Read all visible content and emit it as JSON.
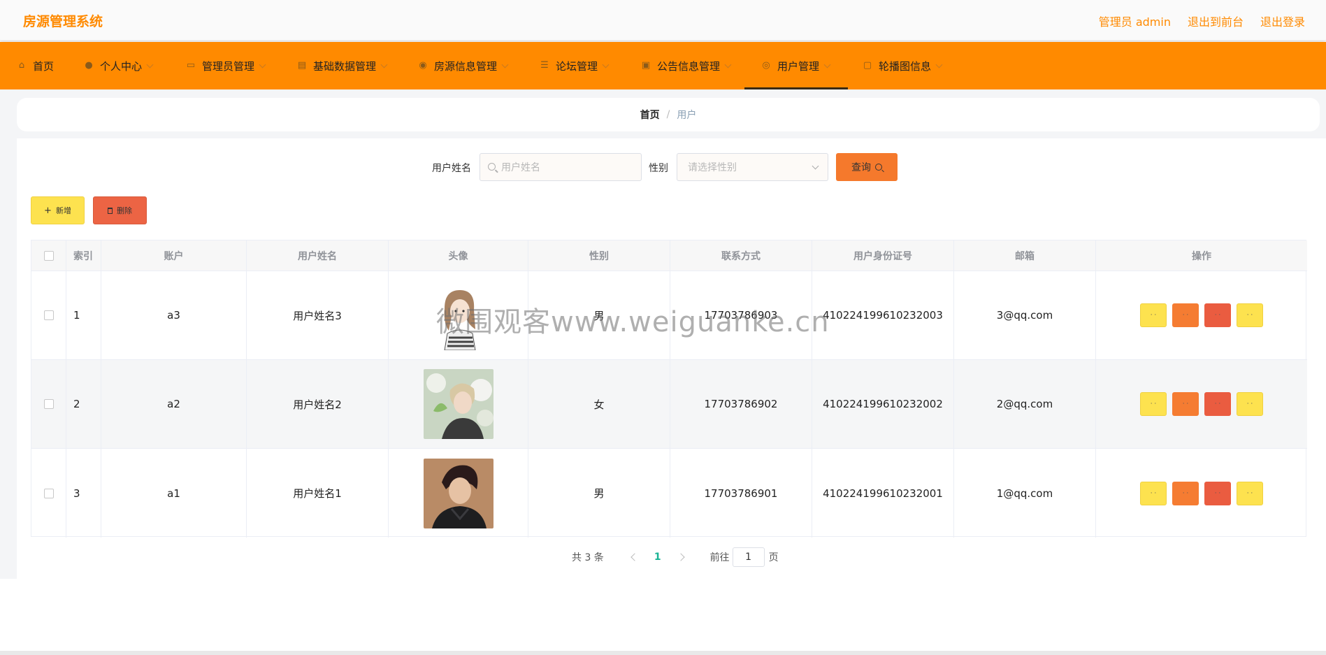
{
  "header": {
    "brand": "房源管理系统",
    "admin_label": "管理员 admin",
    "front_link": "退出到前台",
    "logout_link": "退出登录"
  },
  "nav": {
    "items": [
      {
        "label": "首页",
        "icon": "home-icon"
      },
      {
        "label": "个人中心",
        "icon": "user-icon"
      },
      {
        "label": "管理员管理",
        "icon": "monitor-icon"
      },
      {
        "label": "基础数据管理",
        "icon": "briefcase-icon"
      },
      {
        "label": "房源信息管理",
        "icon": "database-icon"
      },
      {
        "label": "论坛管理",
        "icon": "sliders-icon"
      },
      {
        "label": "公告信息管理",
        "icon": "chat-icon"
      },
      {
        "label": "用户管理",
        "icon": "compass-icon",
        "active": true
      },
      {
        "label": "轮播图信息",
        "icon": "image-icon"
      }
    ]
  },
  "breadcrumb": {
    "home": "首页",
    "separator": "/",
    "current": "用户"
  },
  "search": {
    "name_label": "用户姓名",
    "name_placeholder": "用户姓名",
    "gender_label": "性别",
    "gender_placeholder": "请选择性别",
    "query_button": "查询"
  },
  "actions": {
    "add": "新增",
    "delete": "删除"
  },
  "table": {
    "columns": [
      "索引",
      "账户",
      "用户姓名",
      "头像",
      "性别",
      "联系方式",
      "用户身份证号",
      "邮箱",
      "操作"
    ],
    "rows": [
      {
        "index": "1",
        "account": "a3",
        "name": "用户姓名3",
        "gender": "男",
        "phone": "17703786903",
        "id_number": "410224199610232003",
        "email": "3@qq.com"
      },
      {
        "index": "2",
        "account": "a2",
        "name": "用户姓名2",
        "gender": "女",
        "phone": "17703786902",
        "id_number": "410224199610232002",
        "email": "2@qq.com"
      },
      {
        "index": "3",
        "account": "a1",
        "name": "用户姓名1",
        "gender": "男",
        "phone": "17703786901",
        "id_number": "410224199610232001",
        "email": "1@qq.com"
      }
    ],
    "op_labels": [
      "· ·",
      "· ·",
      "· ·",
      "· ·"
    ]
  },
  "pagination": {
    "total": "共 3 条",
    "current_page": "1",
    "goto_label": "前往",
    "goto_value": "1",
    "page_suffix": "页"
  },
  "watermark": "微围观客www.weiguanke.cn",
  "colors": {
    "brand": "#ff8a00",
    "nav_bg": "#ff8a00",
    "query": "#f5792c",
    "add": "#fde24f",
    "delete": "#ec6444",
    "page_active": "#1ab394"
  }
}
